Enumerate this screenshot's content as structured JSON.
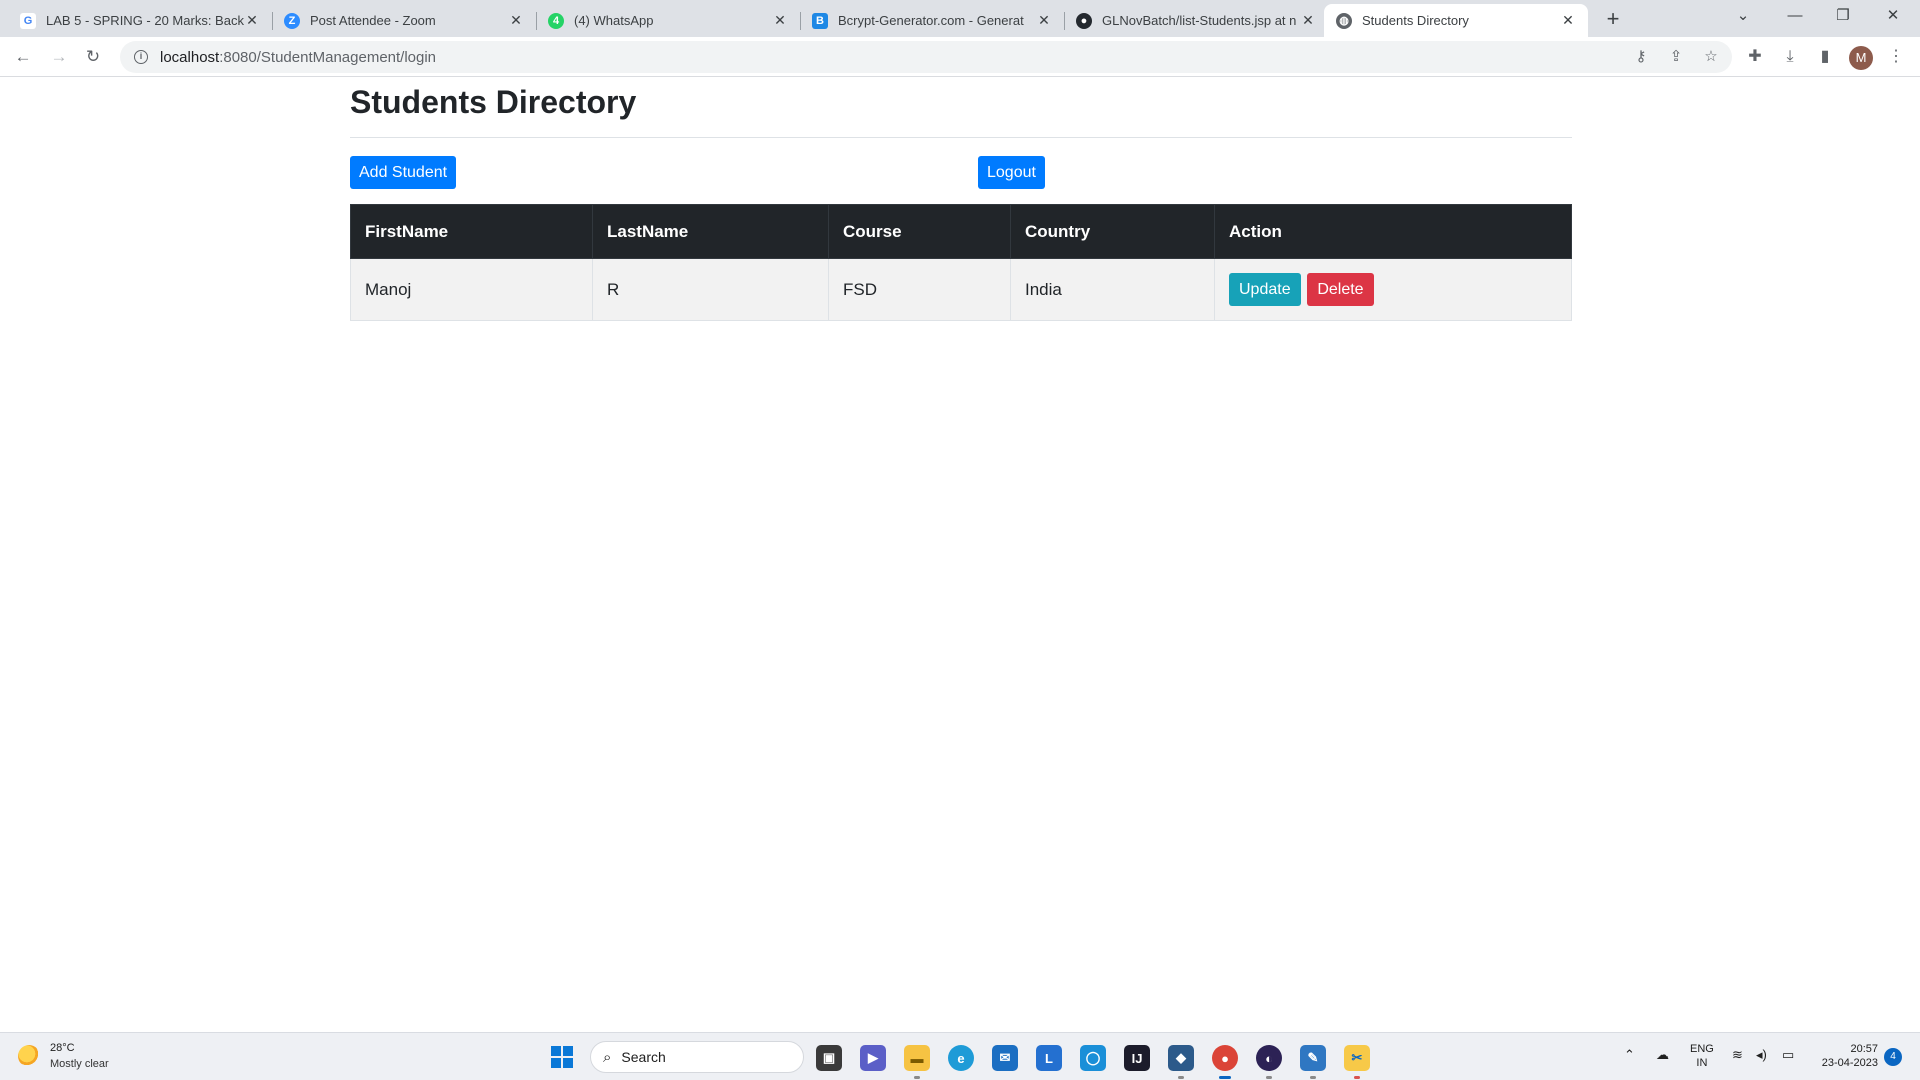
{
  "browser": {
    "tabs": [
      {
        "title": "LAB 5 - SPRING - 20 Marks: Back",
        "icon": "google-icon"
      },
      {
        "title": "Post Attendee - Zoom",
        "icon": "zoom-icon"
      },
      {
        "title": "(4) WhatsApp",
        "icon": "whatsapp-icon"
      },
      {
        "title": "Bcrypt-Generator.com - Generat",
        "icon": "bcrypt-icon"
      },
      {
        "title": "GLNovBatch/list-Students.jsp at n",
        "icon": "github-icon"
      },
      {
        "title": "Students Directory",
        "icon": "globe-icon"
      }
    ],
    "address": {
      "host": "localhost",
      "path": ":8080/StudentManagement/login"
    },
    "profile_initial": "M"
  },
  "page": {
    "title": "Students Directory",
    "add_button": "Add Student",
    "logout_button": "Logout",
    "columns": [
      "FirstName",
      "LastName",
      "Course",
      "Country",
      "Action"
    ],
    "rows": [
      {
        "first": "Manoj",
        "last": "R",
        "course": "FSD",
        "country": "India",
        "update": "Update",
        "delete": "Delete"
      }
    ]
  },
  "colors": {
    "primary": "#007bff",
    "info": "#17a2b8",
    "danger": "#dc3545",
    "table_header": "#212529"
  },
  "taskbar": {
    "weather": {
      "temp": "28°C",
      "desc": "Mostly clear"
    },
    "search_label": "Search",
    "language": {
      "line1": "ENG",
      "line2": "IN"
    },
    "clock": {
      "time": "20:57",
      "date": "23-04-2023"
    },
    "notifications": "4"
  }
}
